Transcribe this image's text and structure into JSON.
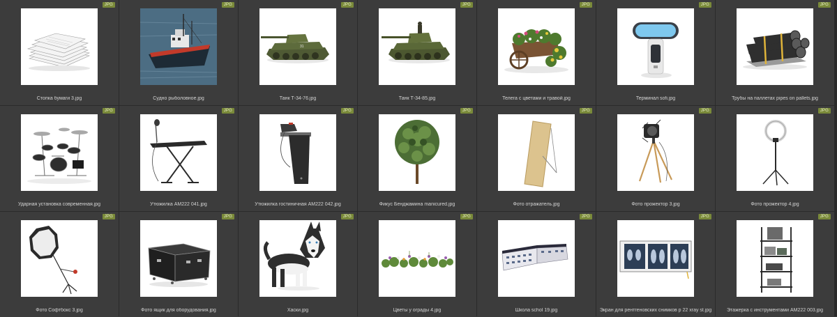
{
  "badge_label": "JPG",
  "colors": {
    "background": "#3a3a3a",
    "badge": "#7a8a3a",
    "caption": "#d4d4d4"
  },
  "tiles": [
    {
      "name": "Стопка бумаги 3.jpg",
      "icon": "paper-stack"
    },
    {
      "name": "Судно рыболовное.jpg",
      "icon": "fishing-boat"
    },
    {
      "name": "Танк Т-34-76.jpg",
      "icon": "tank"
    },
    {
      "name": "Танк Т-34-85.jpg",
      "icon": "tank"
    },
    {
      "name": "Телега с цветами и травой.jpg",
      "icon": "flower-cart"
    },
    {
      "name": "Терминал sofi.jpg",
      "icon": "terminal"
    },
    {
      "name": "Трубы на паллетах pipes on pallets.jpg",
      "icon": "pipes"
    },
    {
      "name": "Ударная установка современная.jpg",
      "icon": "drum-kit"
    },
    {
      "name": "Утюжилка AM222 041.jpg",
      "icon": "ironing-board"
    },
    {
      "name": "Утюжилка гостиничная AM222 042.jpg",
      "icon": "ironing-board-wall"
    },
    {
      "name": "Фикус Бенджамина manicured.jpg",
      "icon": "ficus-tree"
    },
    {
      "name": "Фото отражатель.jpg",
      "icon": "photo-reflector"
    },
    {
      "name": "Фото прожектор 3.jpg",
      "icon": "spotlight"
    },
    {
      "name": "Фото прожектор 4.jpg",
      "icon": "ring-light"
    },
    {
      "name": "Фото Софтбокс 3.jpg",
      "icon": "softbox"
    },
    {
      "name": "Фото ящик для оборудования.jpg",
      "icon": "equipment-case"
    },
    {
      "name": "Хаски.jpg",
      "icon": "husky-dog"
    },
    {
      "name": "Цветы у ограды 4.jpg",
      "icon": "flower-row"
    },
    {
      "name": "Школа schol 19.jpg",
      "icon": "school-building"
    },
    {
      "name": "Экран для рентгеновских снимков р 22 xray st.jpg",
      "icon": "xray-screen"
    },
    {
      "name": "Этажерка с инструментами AM222 003.jpg",
      "icon": "tool-shelf"
    }
  ]
}
